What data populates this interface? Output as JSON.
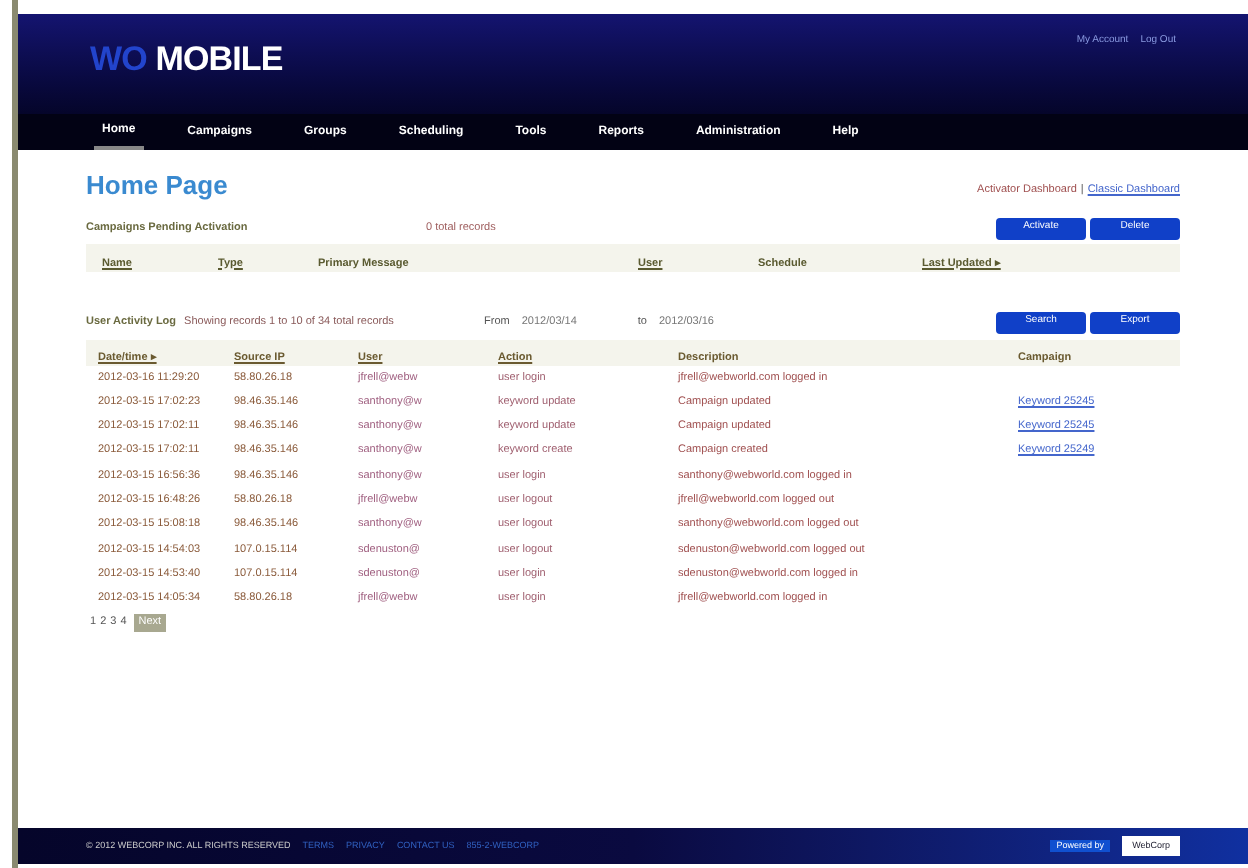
{
  "header": {
    "logo_prefix": "WO",
    "logo_name": "MOBILE",
    "account_links": [
      "My Account",
      "Log Out"
    ]
  },
  "nav": [
    {
      "label": "Home",
      "selected": true
    },
    {
      "label": "Campaigns",
      "selected": false
    },
    {
      "label": "Groups",
      "selected": false
    },
    {
      "label": "Scheduling",
      "selected": false
    },
    {
      "label": "Tools",
      "selected": false
    },
    {
      "label": "Reports",
      "selected": false
    },
    {
      "label": "Administration",
      "selected": false
    },
    {
      "label": "Help",
      "selected": false
    }
  ],
  "page_title": "Home Page",
  "dashboard_switch": {
    "current": "Activator Dashboard",
    "separator": "|",
    "link": "Classic Dashboard"
  },
  "pending": {
    "title": "Campaigns Pending Activation",
    "count": "0 total records",
    "buttons": [
      "Activate",
      "Delete"
    ],
    "columns": [
      "Name",
      "Type",
      "Primary Message",
      "User",
      "Schedule",
      "Last Updated ▸"
    ]
  },
  "activity": {
    "title": "User Activity Log",
    "showing": "Showing records 1 to 10 of 34 total records",
    "from_label": "From",
    "from": "2012/03/14",
    "to_label": "to",
    "to": "2012/03/16",
    "buttons": [
      "Search",
      "Export"
    ],
    "columns": [
      "Date/time ▸",
      "Source IP",
      "User",
      "Action",
      "Description",
      "Campaign"
    ],
    "rows": [
      {
        "date": "2012-03-16 11:29:20",
        "ip": "58.80.26.18",
        "user": "jfrell@webw",
        "action": "user login",
        "description": "jfrell@webworld.com logged in",
        "campaign": ""
      },
      {
        "date": "2012-03-15 17:02:23",
        "ip": "98.46.35.146",
        "user": "santhony@w",
        "action": "keyword update",
        "description": "Campaign updated",
        "campaign": "Keyword 25245"
      },
      {
        "date": "2012-03-15 17:02:11",
        "ip": "98.46.35.146",
        "user": "santhony@w",
        "action": "keyword update",
        "description": "Campaign updated",
        "campaign": "Keyword 25245"
      },
      {
        "date": "2012-03-15 17:02:11",
        "ip": "98.46.35.146",
        "user": "santhony@w",
        "action": "keyword create",
        "description": "Campaign created",
        "campaign": "Keyword 25249"
      },
      {
        "date": "2012-03-15 16:56:36",
        "ip": "98.46.35.146",
        "user": "santhony@w",
        "action": "user login",
        "description": "santhony@webworld.com logged in",
        "campaign": ""
      },
      {
        "date": "2012-03-15 16:48:26",
        "ip": "58.80.26.18",
        "user": "jfrell@webw",
        "action": "user logout",
        "description": "jfrell@webworld.com logged out",
        "campaign": ""
      },
      {
        "date": "2012-03-15 15:08:18",
        "ip": "98.46.35.146",
        "user": "santhony@w",
        "action": "user logout",
        "description": "santhony@webworld.com logged out",
        "campaign": ""
      },
      {
        "date": "2012-03-15 14:54:03",
        "ip": "107.0.15.114",
        "user": "sdenuston@",
        "action": "user logout",
        "description": "sdenuston@webworld.com logged out",
        "campaign": ""
      },
      {
        "date": "2012-03-15 14:53:40",
        "ip": "107.0.15.114",
        "user": "sdenuston@",
        "action": "user login",
        "description": "sdenuston@webworld.com logged in",
        "campaign": ""
      },
      {
        "date": "2012-03-15 14:05:34",
        "ip": "58.80.26.18",
        "user": "jfrell@webw",
        "action": "user login",
        "description": "jfrell@webworld.com logged in",
        "campaign": ""
      }
    ],
    "pages": [
      "1",
      "2",
      "3",
      "4"
    ],
    "next": "Next"
  },
  "footer": {
    "copyright": "© 2012 WEBCORP INC. ALL RIGHTS RESERVED",
    "links": [
      "TERMS",
      "PRIVACY",
      "CONTACT US",
      "855-2-WEBCORP"
    ],
    "badge": "Powered by",
    "partner": "WebCorp"
  }
}
